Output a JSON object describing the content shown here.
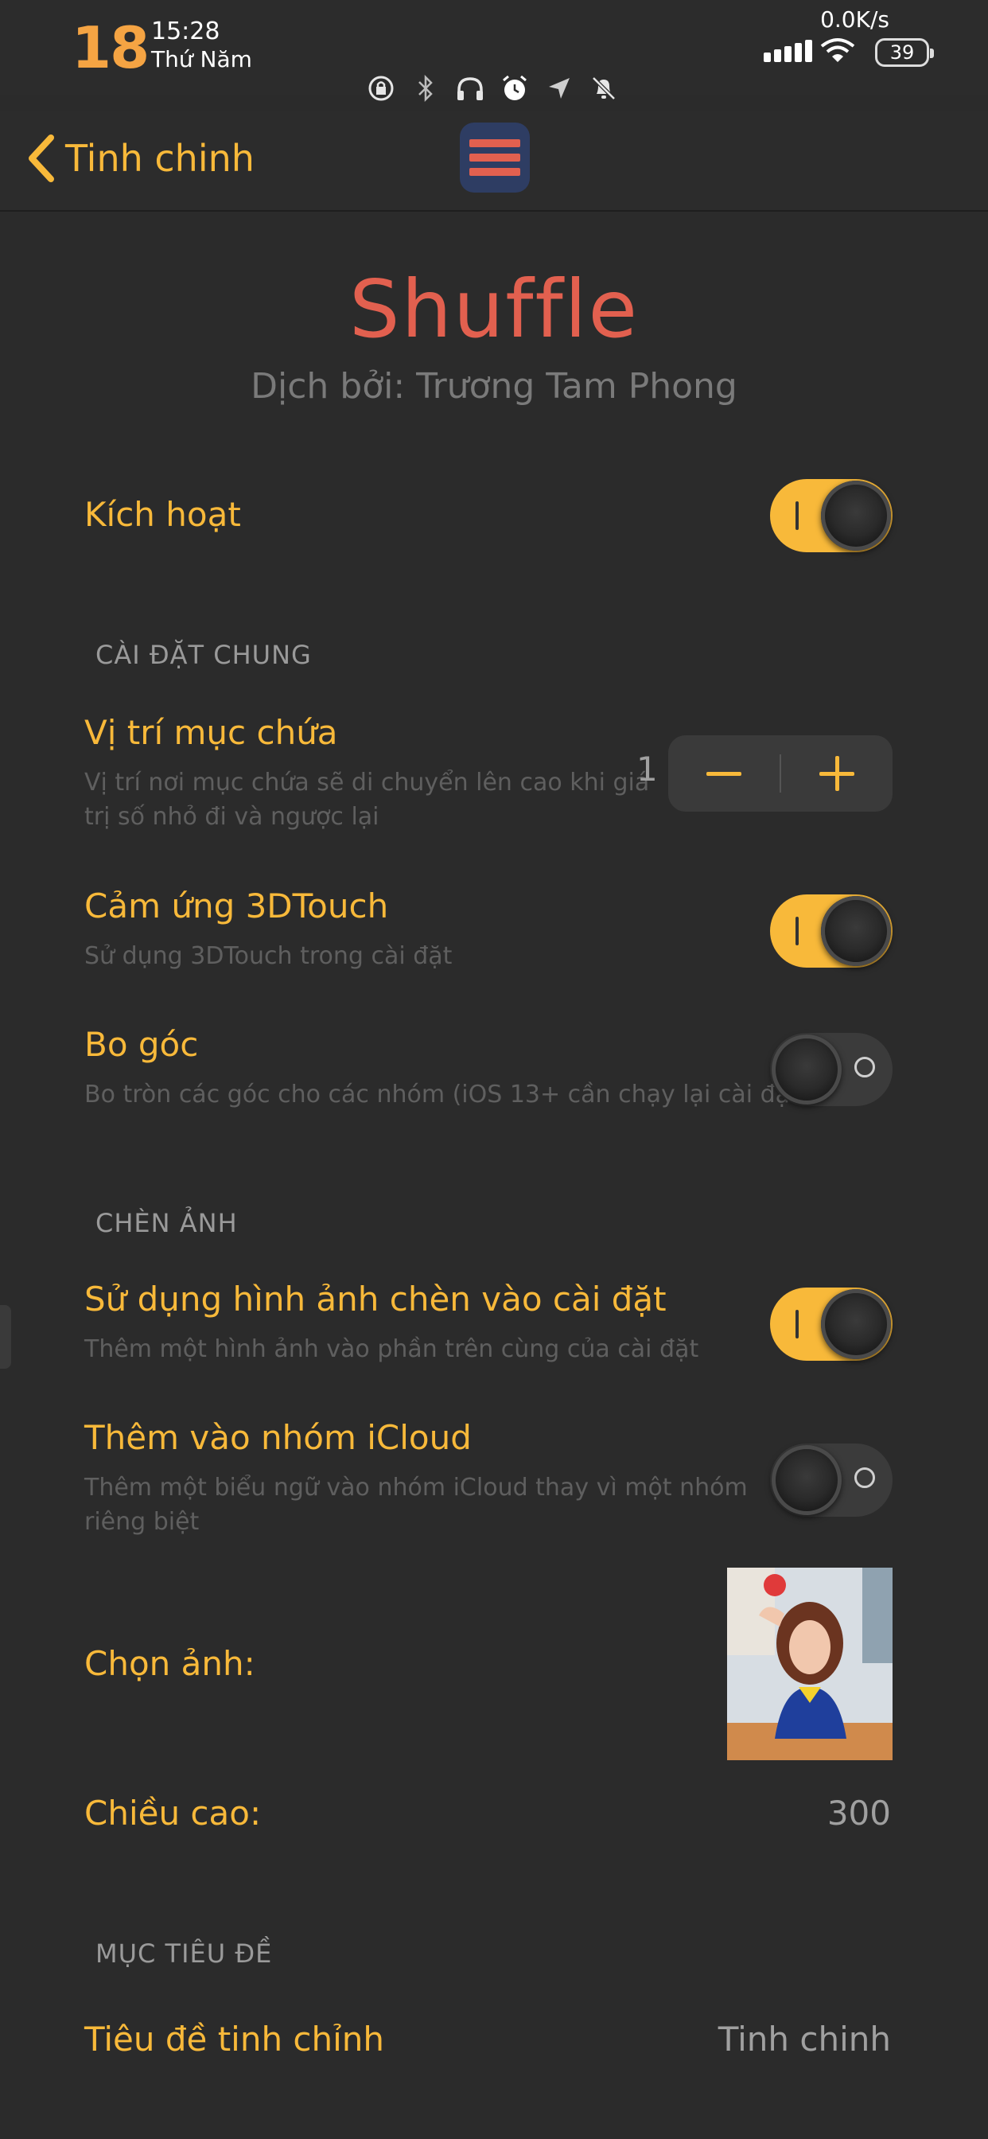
{
  "status_bar": {
    "date_number": "18",
    "time": "15:28",
    "weekday": "Thứ Năm",
    "network_speed": "0.0K/s",
    "battery": "39"
  },
  "nav": {
    "back_label": "Tinh chinh"
  },
  "header": {
    "title": "Shuffle",
    "subtitle": "Dịch bởi: Trương Tam Phong"
  },
  "enable": {
    "label": "Kích hoạt",
    "on": true
  },
  "general": {
    "section_title": "CÀI ĐẶT CHUNG",
    "position": {
      "label": "Vị trí mục chứa",
      "description_line1": "Vị trí nơi mục chứa sẽ di chuyển lên cao khi giá",
      "description_line2": "trị số nhỏ đi và ngược lại",
      "value": "1"
    },
    "touch3d": {
      "label": "Cảm ứng 3DTouch",
      "description": "Sử dụng 3DTouch trong cài đặt",
      "on": true
    },
    "corners": {
      "label": "Bo góc",
      "description": "Bo tròn các góc cho các nhóm (iOS 13+ cần chạy lại cài đặt)",
      "on": false
    }
  },
  "image_section": {
    "section_title": "CHÈN ẢNH",
    "use_image": {
      "label": "Sử dụng hình ảnh chèn vào cài đặt",
      "description": "Thêm một hình ảnh vào phần trên cùng của cài đặt",
      "on": true
    },
    "icloud": {
      "label": "Thêm vào nhóm iCloud",
      "description_line1": "Thêm một biểu ngữ vào nhóm iCloud thay vì một nhóm",
      "description_line2": "riêng biệt",
      "on": false
    },
    "choose_image": {
      "label": "Chọn ảnh:"
    },
    "height": {
      "label": "Chiều cao:",
      "value": "300"
    }
  },
  "title_section": {
    "section_title": "MỤC TIÊU ĐỀ",
    "tweak_title": {
      "label": "Tiêu đề tinh chỉnh",
      "value": "Tinh chinh"
    }
  },
  "colors": {
    "accent": "#f8b93a",
    "title": "#e2604f",
    "background": "#2b2b2b"
  },
  "icons": [
    "rotation-lock-icon",
    "bluetooth-icon",
    "headphones-icon",
    "alarm-icon",
    "location-icon",
    "mute-icon"
  ]
}
